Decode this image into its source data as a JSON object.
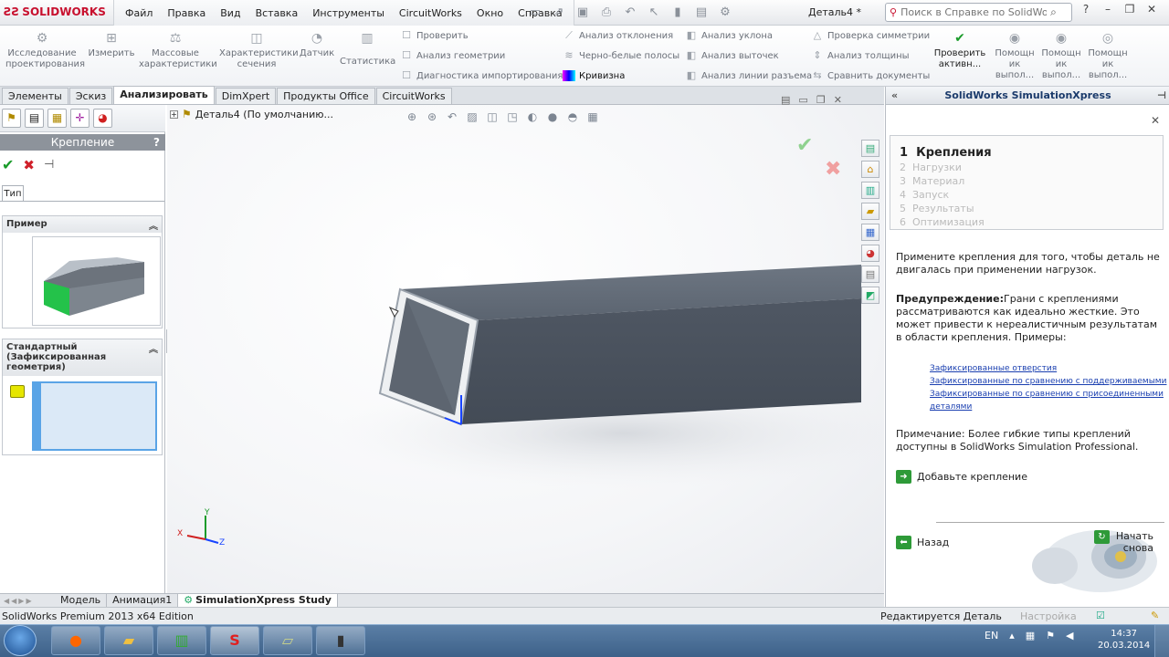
{
  "app": {
    "logo": "SOLIDWORKS",
    "doc_title": "Деталь4 *",
    "search_placeholder": "Поиск в Справке по SolidWorks"
  },
  "menu": [
    "Файл",
    "Правка",
    "Вид",
    "Вставка",
    "Инструменты",
    "CircuitWorks",
    "Окно",
    "Справка"
  ],
  "ribbon": {
    "big": [
      {
        "label": "Исследование проектирования",
        "icon": "design-study-icon"
      },
      {
        "label": "Измерить",
        "icon": "measure-icon"
      },
      {
        "label": "Массовые характеристики",
        "icon": "mass-properties-icon"
      },
      {
        "label": "Характеристики сечения",
        "icon": "section-properties-icon"
      },
      {
        "label": "Датчик",
        "icon": "sensor-icon"
      },
      {
        "label": "Статистика",
        "icon": "statistics-icon"
      }
    ],
    "small_col1": [
      "Проверить",
      "Анализ геометрии",
      "Диагностика импортирования"
    ],
    "small_col2": [
      "Анализ отклонения",
      "Черно-белые полосы",
      "Кривизна"
    ],
    "small_col3": [
      "Анализ уклона",
      "Анализ выточек",
      "Анализ линии разъема"
    ],
    "small_col4": [
      "Проверка симметрии",
      "Анализ толщины",
      "Сравнить документы"
    ],
    "check_active": "Проверить активн...",
    "help1": "Помощн ик выпол...",
    "help2": "Помощн ик выпол...",
    "help3": "Помощн ик выпол..."
  },
  "tabs": [
    "Элементы",
    "Эскиз",
    "Анализировать",
    "DimXpert",
    "Продукты Office",
    "CircuitWorks"
  ],
  "active_tab": "Анализировать",
  "property_manager": {
    "title": "Крепление",
    "help": "?",
    "type_tab": "Тип",
    "group1_title": "Пример",
    "group2_title": "Стандартный (Зафиксированная геометрия)"
  },
  "tree": {
    "item": "Деталь4  (По умолчанию..."
  },
  "triad": {
    "x": "X",
    "y": "Y",
    "z": "Z"
  },
  "bottom_tabs": [
    "Модель",
    "Анимация1",
    "SimulationXpress Study"
  ],
  "status": {
    "left": "SolidWorks Premium 2013 x64 Edition",
    "right": "Редактируется Деталь",
    "custom": "Настройка"
  },
  "simxpress": {
    "title": "SolidWorks SimulationXpress",
    "steps": [
      {
        "n": "1",
        "label": "Крепления"
      },
      {
        "n": "2",
        "label": "Нагрузки"
      },
      {
        "n": "3",
        "label": "Материал"
      },
      {
        "n": "4",
        "label": "Запуск"
      },
      {
        "n": "5",
        "label": "Результаты"
      },
      {
        "n": "6",
        "label": "Оптимизация"
      }
    ],
    "desc": "Примените крепления для того, чтобы деталь не двигалась при применении нагрузок.",
    "warn_bold": "Предупреждение:",
    "warn_text": "Грани с креплениями рассматриваются как идеально жесткие. Это может привести к нереалистичным результатам в области крепления. Примеры:",
    "links": [
      "Зафиксированные отверстия",
      "Зафиксированные по сравнению с поддерживаемыми",
      "Зафиксированные по сравнению с присоединенными деталями"
    ],
    "note": "Примечание: Более гибкие типы креплений доступны в SolidWorks Simulation Professional.",
    "add": "Добавьте крепление",
    "back": "Назад",
    "restart": "Начать снова"
  },
  "taskbar": {
    "lang": "EN",
    "time": "14:37",
    "date": "20.03.2014"
  },
  "colors": {
    "accent": "#c8102e",
    "link": "#1a3fb0",
    "green": "#2e9a38"
  }
}
